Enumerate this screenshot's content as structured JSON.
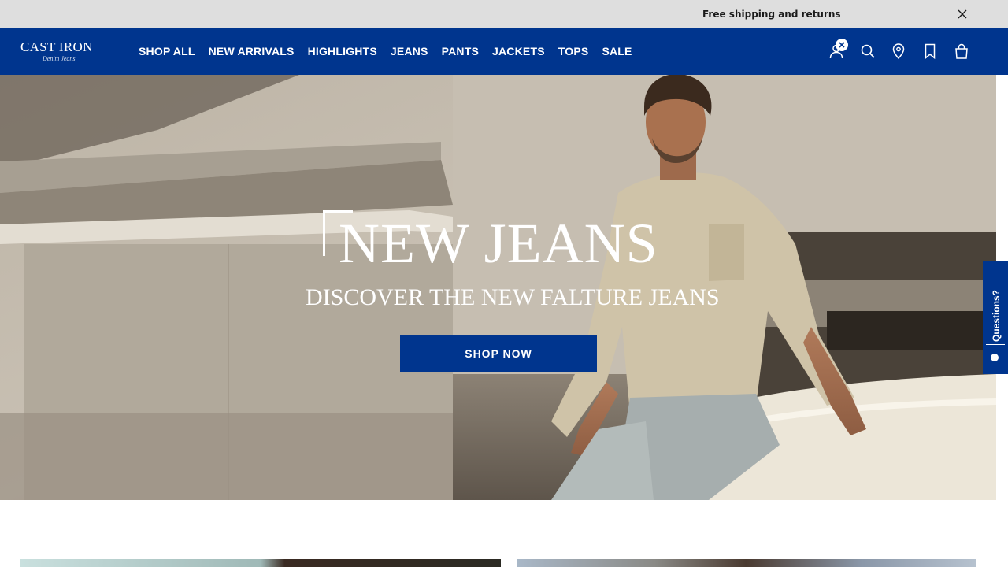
{
  "announcement": {
    "text": "Free shipping and returns",
    "close_icon": "close-icon"
  },
  "header": {
    "logo": {
      "main": "CAST IRON",
      "sub": "Denim Jeans"
    },
    "nav": [
      "SHOP ALL",
      "NEW ARRIVALS",
      "HIGHLIGHTS",
      "JEANS",
      "PANTS",
      "JACKETS",
      "TOPS",
      "SALE"
    ],
    "icons": [
      "account-icon",
      "search-icon",
      "store-locator-icon",
      "wishlist-icon",
      "cart-icon"
    ],
    "colors": {
      "brand": "#00358e"
    }
  },
  "hero": {
    "title": "NEW JEANS",
    "subtitle": "DISCOVER THE NEW FALTURE JEANS",
    "cta": "SHOP NOW"
  },
  "feedback": {
    "label": "Questions?"
  }
}
